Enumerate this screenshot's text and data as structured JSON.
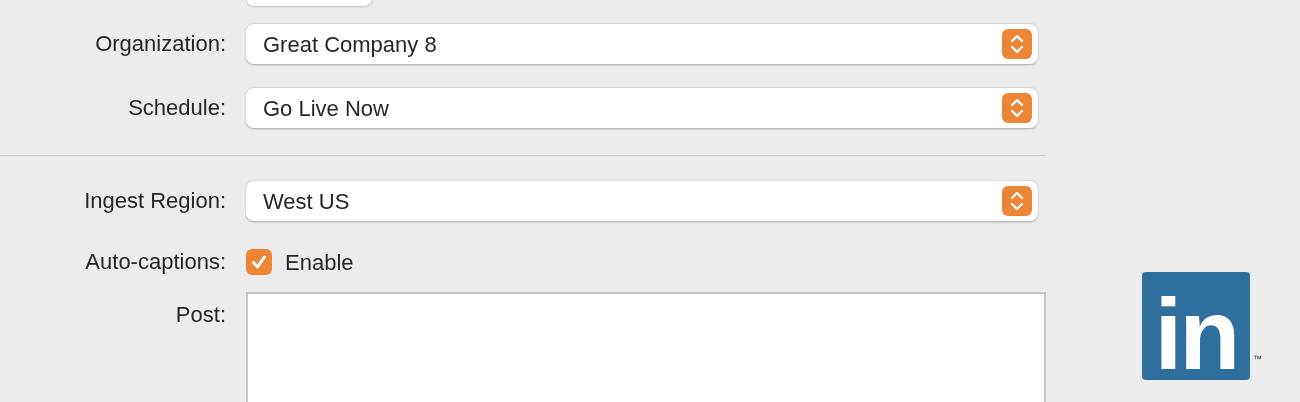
{
  "form_top": [
    {
      "kind": "popup",
      "label": "Organization:",
      "value": "Great Company 8"
    },
    {
      "kind": "popup",
      "label": "Schedule:",
      "value": "Go Live Now"
    }
  ],
  "form_bottom": [
    {
      "kind": "popup",
      "label": "Ingest Region:",
      "value": "West US"
    },
    {
      "kind": "checkbox",
      "label": "Auto-captions:",
      "value": "Enable",
      "checked": true
    },
    {
      "kind": "textarea",
      "label": "Post:"
    }
  ],
  "logo": {
    "text": "in",
    "trademark": "™"
  }
}
